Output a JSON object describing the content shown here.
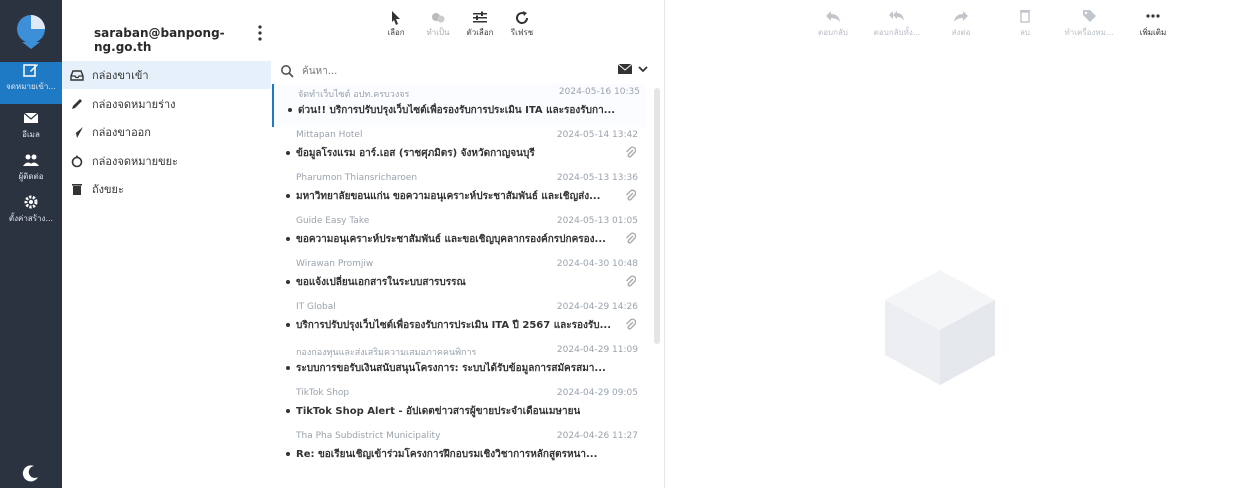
{
  "account": "saraban@banpong-ng.go.th",
  "taskbar": {
    "items": [
      {
        "label": "จดหมายเข้า..."
      },
      {
        "label": "อีเมล"
      },
      {
        "label": "ผู้ติดต่อ"
      },
      {
        "label": "ตั้งค่าสร้าง..."
      }
    ]
  },
  "folders": [
    {
      "label": "กล่องขาเข้า"
    },
    {
      "label": "กล่องจดหมายร่าง"
    },
    {
      "label": "กล่องขาออก"
    },
    {
      "label": "กล่องจดหมายขยะ"
    },
    {
      "label": "ถังขยะ"
    }
  ],
  "list_toolbar": {
    "select": "เลือก",
    "read": "ทำเป็น",
    "filter": "ตัวเลือก",
    "refresh": "รีเฟรช"
  },
  "search": {
    "placeholder": "ค้นหา..."
  },
  "messages": [
    {
      "sender": "จัดทำเว็บไซต์ อปท.ครบวงจร",
      "date": "2024-05-16 10:35",
      "subject": "ด่วน!! บริการปรับปรุงเว็บไซต์เพื่อรองรับการประเมิน ITA และรองรับกา..."
    },
    {
      "sender": "Mittapan Hotel",
      "date": "2024-05-14 13:42",
      "subject": "ข้อมูลโรงแรม อาร์.เอส (ราชศุภมิตร) จังหวัดกาญจนบุรี"
    },
    {
      "sender": "Pharumon Thiansricharoen",
      "date": "2024-05-13 13:36",
      "subject": "มหาวิทยาลัยขอนแก่น ขอความอนุเคราะห์ประชาสัมพันธ์ และเชิญส่ง..."
    },
    {
      "sender": "Guide Easy Take",
      "date": "2024-05-13 01:05",
      "subject": "ขอความอนุเคราะห์ประชาสัมพันธ์ และขอเชิญบุคลากรองค์กรปกครอง..."
    },
    {
      "sender": "Wirawan Promjiw",
      "date": "2024-04-30 10:48",
      "subject": "ขอแจ้งเปลี่ยนเอกสารในระบบสารบรรณ"
    },
    {
      "sender": "IT Global",
      "date": "2024-04-29 14:26",
      "subject": "บริการปรับปรุงเว็บไซต์เพื่อรองรับการประเมิน ITA ปี 2567 และรองรับ..."
    },
    {
      "sender": "กองกองทุนและส่งเสริมความเสมอภาคคนพิการ",
      "date": "2024-04-29 11:09",
      "subject": "ระบบการขอรับเงินสนับสนุนโครงการ: ระบบได้รับข้อมูลการสมัครสมา..."
    },
    {
      "sender": "TikTok Shop",
      "date": "2024-04-29 09:05",
      "subject": "TikTok Shop Alert - อัปเดตข่าวสารผู้ขายประจำเดือนเมษายน"
    },
    {
      "sender": "Tha Pha Subdistrict Municipality",
      "date": "2024-04-26 11:27",
      "subject": "Re: ขอเรียนเชิญเข้าร่วมโครงการฝึกอบรมเชิงวิชาการหลักสูตรหนา..."
    }
  ],
  "read_toolbar": {
    "reply": "ตอบกลับ",
    "reply_all": "ตอบกลับทั้ง...",
    "forward": "ส่งต่อ",
    "delete": "ลบ",
    "mark": "ทำเครื่องหม...",
    "more": "เพิ่มเติม"
  },
  "colors": {
    "taskbar": "#2b3240",
    "accent": "#1f7ac6",
    "active_folder": "#e6f0fa"
  }
}
